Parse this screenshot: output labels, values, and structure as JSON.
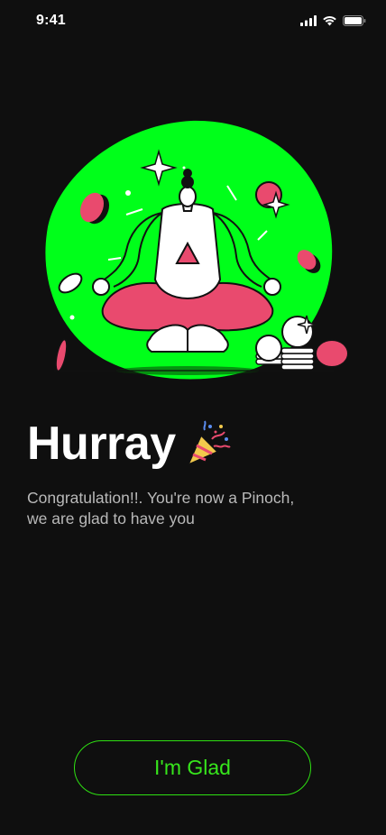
{
  "status_bar": {
    "time": "9:41",
    "icons": [
      "signal-icon",
      "wifi-icon",
      "battery-icon"
    ]
  },
  "illustration": {
    "icon": "meditation-illustration",
    "colors": {
      "blob": "#00ff1a",
      "accent": "#e94a6e",
      "outline": "#111111",
      "figure": "#ffffff"
    }
  },
  "headline": {
    "title": "Hurray",
    "emoji_icon": "party-popper-icon"
  },
  "message": {
    "line1": "Congratulation!!. You're now a Pinoch,",
    "line2": "we are glad to have you"
  },
  "actions": {
    "glad_label": "I'm Glad"
  },
  "colors": {
    "background": "#0f0f0f",
    "accent": "#2ee012",
    "text": "#ffffff",
    "muted": "#b9b9b9"
  }
}
